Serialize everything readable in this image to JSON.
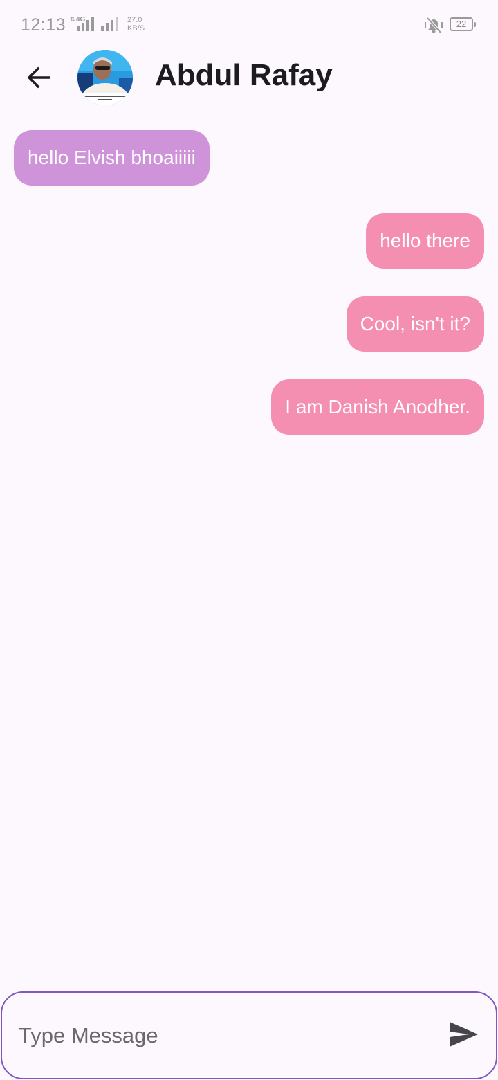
{
  "status_bar": {
    "time": "12:13",
    "network_type": "4G",
    "speed_value": "27.0",
    "speed_unit": "KB/S",
    "battery_level": "22",
    "icons": [
      "signal-icon",
      "signal-icon",
      "vibrate-mute-icon",
      "battery-icon"
    ]
  },
  "header": {
    "back_icon": "arrow-left-icon",
    "contact_name": "Abdul Rafay"
  },
  "messages": [
    {
      "direction": "received",
      "text": "hello Elvish bhoaiiiii"
    },
    {
      "direction": "sent",
      "text": "hello there"
    },
    {
      "direction": "sent",
      "text": "Cool, isn't it?"
    },
    {
      "direction": "sent",
      "text": "I am Danish Anodher."
    }
  ],
  "composer": {
    "placeholder": "Type Message",
    "value": "",
    "send_icon": "send-icon"
  },
  "colors": {
    "background": "#fdf8fd",
    "received_bubble": "#ce93d8",
    "sent_bubble": "#f48fb1",
    "composer_border": "#7e57c2",
    "title_text": "#1c1b1f"
  }
}
